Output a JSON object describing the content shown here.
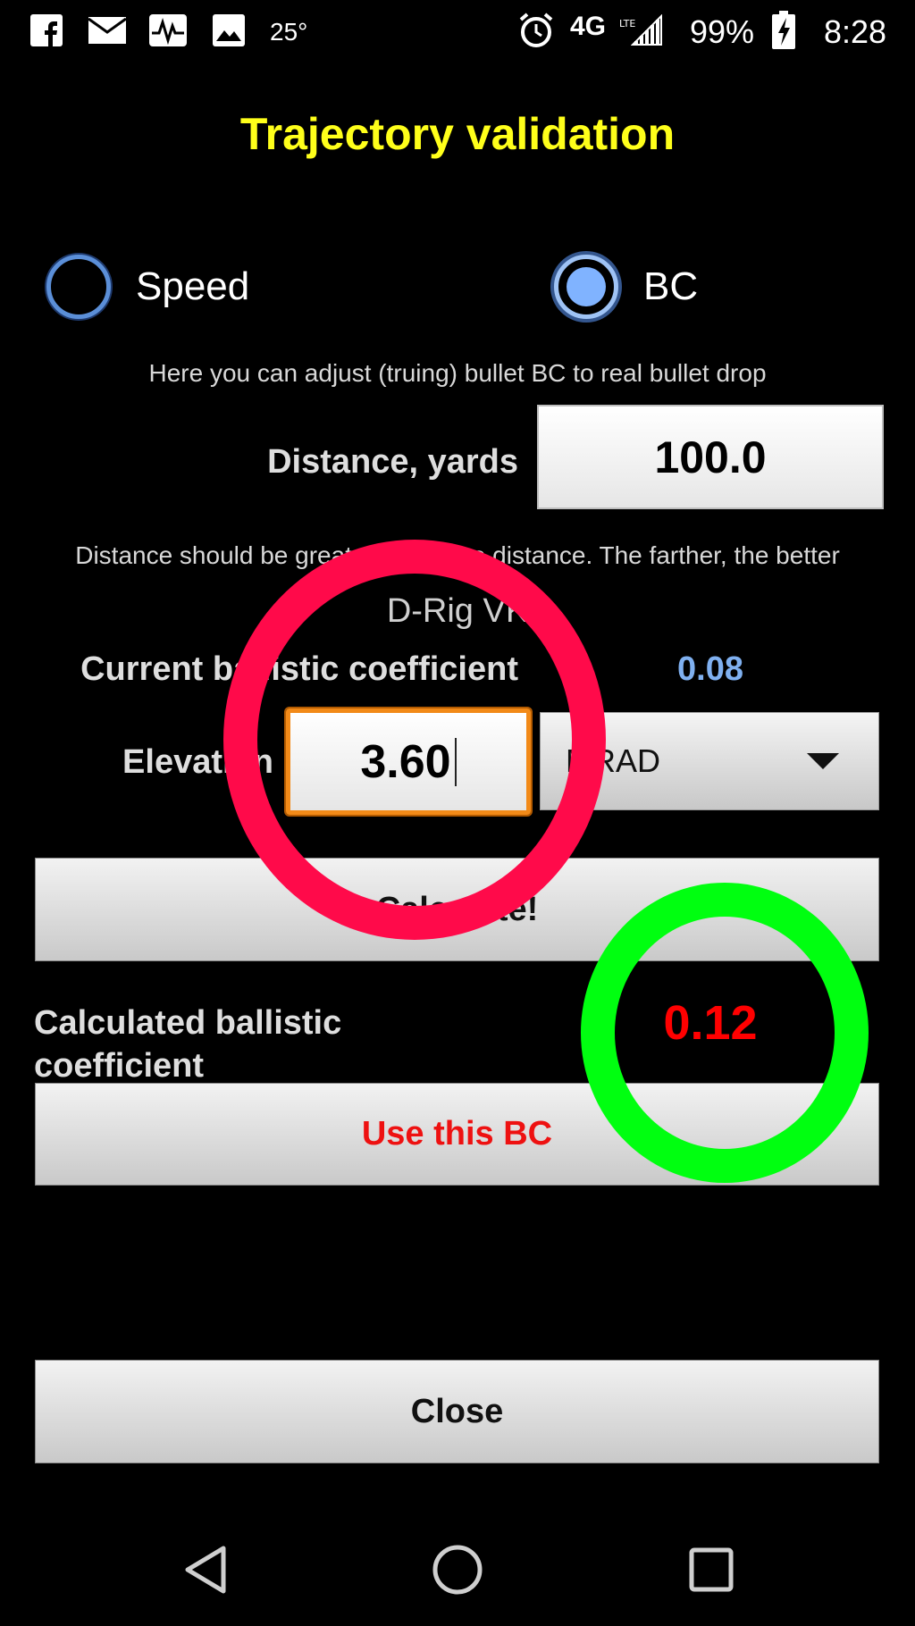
{
  "status_bar": {
    "temperature": "25°",
    "network": "4G",
    "battery_percent": "99%",
    "time": "8:28",
    "icons": [
      "facebook-icon",
      "mail-icon",
      "activity-icon",
      "image-icon",
      "alarm-icon",
      "lte-icon",
      "signal-icon",
      "battery-charging-icon"
    ]
  },
  "title": "Trajectory validation",
  "mode": {
    "options": [
      {
        "label": "Speed",
        "selected": false
      },
      {
        "label": "BC",
        "selected": true
      }
    ]
  },
  "mode_hint": "Here you can adjust (truing) bullet BC to real bullet drop",
  "distance": {
    "label": "Distance, yards",
    "value": "100.0"
  },
  "distance_hint": "Distance should be greater than zero distance. The farther, the better",
  "profile_name": "D-Rig VK",
  "current_bc": {
    "label": "Current ballistic coefficient",
    "value": "0.08"
  },
  "elevation": {
    "label": "Elevation",
    "value": "3.60",
    "unit": "MRAD"
  },
  "calculate_button": "Calculate!",
  "calculated_bc": {
    "label": "Calculated ballistic coefficient",
    "value": "0.12"
  },
  "use_bc_button": "Use this BC",
  "close_button": "Close",
  "colors": {
    "title": "#ffff1a",
    "current_bc_value": "#7fb0f0",
    "calculated_bc_value": "#ff0000",
    "use_bc_label": "#ee1111",
    "focus_border": "#f28a18",
    "annotation_red_ring": "#ff0a4a",
    "annotation_green_ring": "#00ff10"
  },
  "navigation": [
    "back-icon",
    "home-icon",
    "recents-icon"
  ]
}
